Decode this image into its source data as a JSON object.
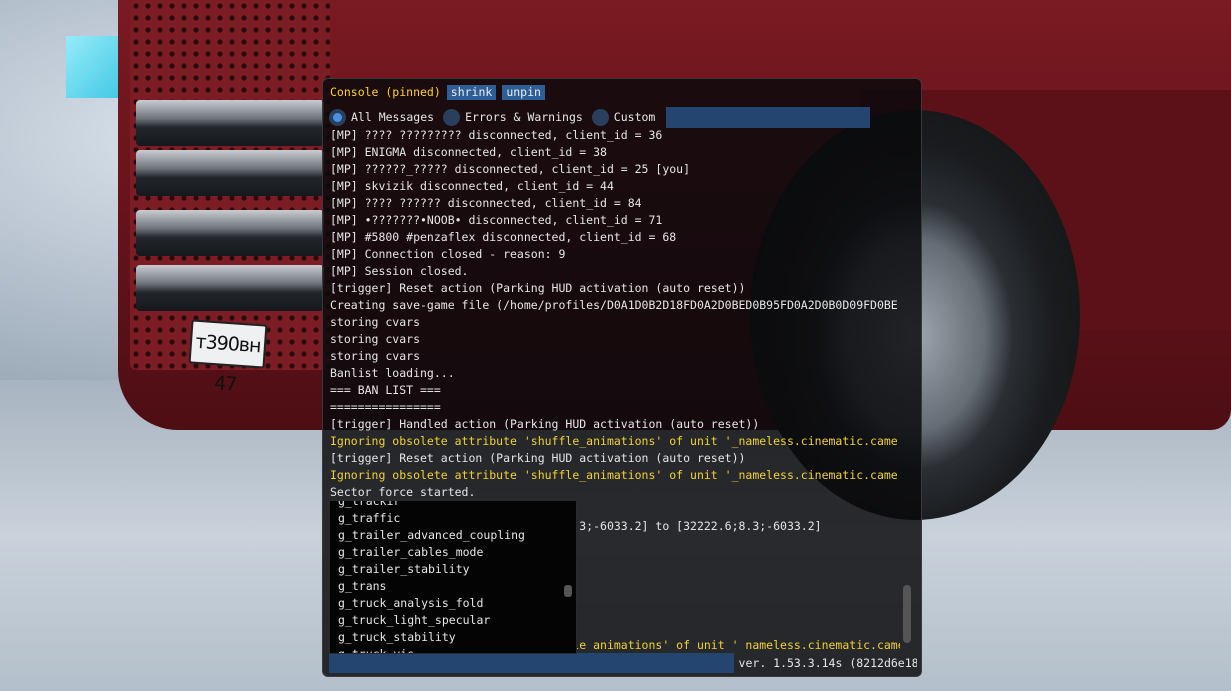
{
  "console": {
    "title": "Console (pinned)",
    "shrink_label": "shrink",
    "unpin_label": "unpin",
    "filters": [
      {
        "label": "All Messages",
        "selected": true
      },
      {
        "label": "Errors & Warnings",
        "selected": false
      },
      {
        "label": "Custom",
        "selected": false
      }
    ],
    "custom_filter_value": "",
    "command_value": "",
    "version": "ver. 1.53.3.14s (8212d6e18"
  },
  "log_lines": [
    {
      "text": "[MP] ???? ????????? disconnected, client_id = 36",
      "level": "info"
    },
    {
      "text": "[MP] ENIGMA disconnected, client_id = 38",
      "level": "info"
    },
    {
      "text": "[MP] ??????_????? disconnected, client_id = 25 [you]",
      "level": "info"
    },
    {
      "text": "[MP] skvizik disconnected, client_id = 44",
      "level": "info"
    },
    {
      "text": "[MP] ???? ?????? disconnected, client_id = 84",
      "level": "info"
    },
    {
      "text": "[MP] •???????•NOOB• disconnected, client_id = 71",
      "level": "info"
    },
    {
      "text": "[MP] #5800 #penzaflex disconnected, client_id = 68",
      "level": "info"
    },
    {
      "text": "[MP] Connection closed - reason: 9",
      "level": "info"
    },
    {
      "text": "[MP] Session closed.",
      "level": "info"
    },
    {
      "text": "[trigger] Reset action (Parking HUD activation (auto reset))",
      "level": "info"
    },
    {
      "text": "Creating save-game file (/home/profiles/D0A1D0B2D18FD0A2D0BED0B95FD0A2D0B0D09FD0BE",
      "level": "info"
    },
    {
      "text": "storing cvars",
      "level": "info"
    },
    {
      "text": "storing cvars",
      "level": "info"
    },
    {
      "text": "storing cvars",
      "level": "info"
    },
    {
      "text": "Banlist loading...",
      "level": "info"
    },
    {
      "text": "=== BAN LIST ===",
      "level": "info"
    },
    {
      "text": "================",
      "level": "info"
    },
    {
      "text": "[trigger] Handled action (Parking HUD activation (auto reset))",
      "level": "info"
    },
    {
      "text": "Ignoring obsolete attribute 'shuffle_animations' of unit '_nameless.cinematic.came",
      "level": "warn"
    },
    {
      "text": "[trigger] Reset action (Parking HUD activation (auto reset))",
      "level": "info"
    },
    {
      "text": "Ignoring obsolete attribute 'shuffle_animations' of unit '_nameless.cinematic.came",
      "level": "warn"
    },
    {
      "text": "Sector force started.",
      "level": "info"
    },
    {
      "text": "",
      "level": "info"
    },
    {
      "text": "[                                 8.3;-6033.2] to [32222.6;8.3;-6033.2]",
      "level": "info"
    },
    {
      "text": "",
      "level": "info"
    },
    {
      "text": "",
      "level": "info"
    },
    {
      "text": "",
      "level": "info"
    },
    {
      "text": "",
      "level": "info"
    },
    {
      "text": "",
      "level": "info"
    },
    {
      "text": "",
      "level": "info"
    },
    {
      "text": "                                 ffle_animations' of unit '_nameless.cinematic.came",
      "level": "warn"
    }
  ],
  "autocomplete": [
    "g_trackir",
    "g_traffic",
    "g_trailer_advanced_coupling",
    "g_trailer_cables_mode",
    "g_trailer_stability",
    "g_trans",
    "g_truck_analysis_fold",
    "g_truck_light_specular",
    "g_truck_stability",
    "g_truck_vis"
  ],
  "scene": {
    "plate_text": "т390вн 47",
    "accent": "#2f5e96",
    "warn_color": "#f2d231",
    "title_color": "#ffd21e"
  }
}
